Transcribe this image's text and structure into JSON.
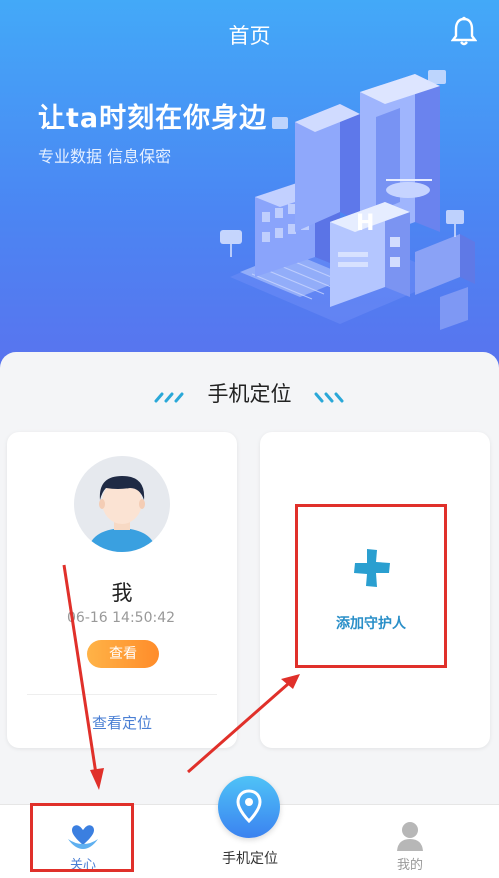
{
  "header": {
    "title": "首页"
  },
  "hero": {
    "slogan": "让ta时刻在你身边",
    "subtitle": "专业数据 信息保密"
  },
  "section": {
    "title": "手机定位"
  },
  "me_card": {
    "name": "我",
    "time": "06-16 14:50:42",
    "view_button": "查看",
    "view_location": "查看定位"
  },
  "add_card": {
    "label": "添加守护人"
  },
  "tabbar": {
    "items": [
      {
        "label": "关心",
        "icon": "heart-hands-icon"
      },
      {
        "label": "手机定位",
        "icon": "location-pin-icon"
      },
      {
        "label": "我的",
        "icon": "person-icon"
      }
    ]
  },
  "colors": {
    "brand_blue": "#4b86f3",
    "accent_orange": "#ff8c2a",
    "annotation_red": "#e0302a",
    "link_blue": "#4a7fd4"
  }
}
